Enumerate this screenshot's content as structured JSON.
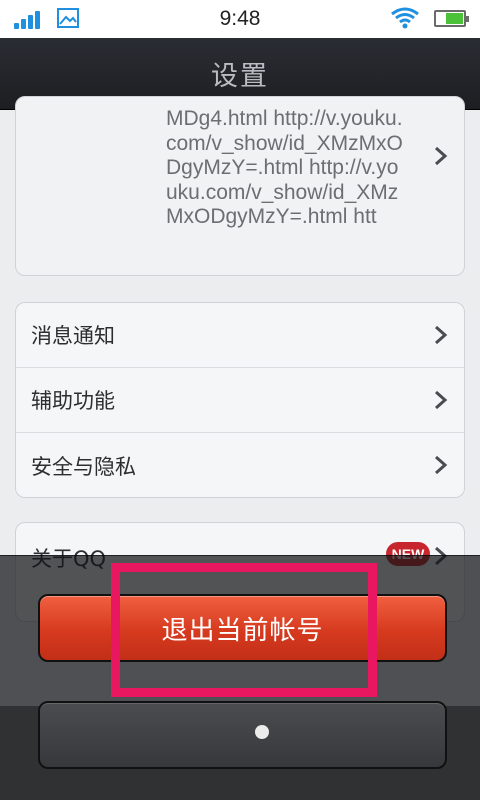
{
  "status_bar": {
    "time": "9:48",
    "icons": [
      "signal-icon",
      "image-icon",
      "wifi-icon",
      "battery-icon"
    ],
    "battery_level": 0.65,
    "accent_color": "#1f8fe0"
  },
  "header": {
    "title": "设置"
  },
  "url_card": {
    "text": "MDg4.html  http://v.youku.com/v_show/id_XMzMxODgyMzY=.html  http://v.youku.com/v_show/id_XMzMxODgyMzY=.html  htt"
  },
  "menu": {
    "items": [
      {
        "label": "消息通知"
      },
      {
        "label": "辅助功能"
      },
      {
        "label": "安全与隐私"
      }
    ]
  },
  "about": {
    "label": "关于QQ",
    "badge": "NEW"
  },
  "action_sheet": {
    "logout_label": "退出当前帐号",
    "logout_color": "#d63a1f",
    "cancel_label": ""
  },
  "highlight": {
    "color": "#e8175f"
  }
}
